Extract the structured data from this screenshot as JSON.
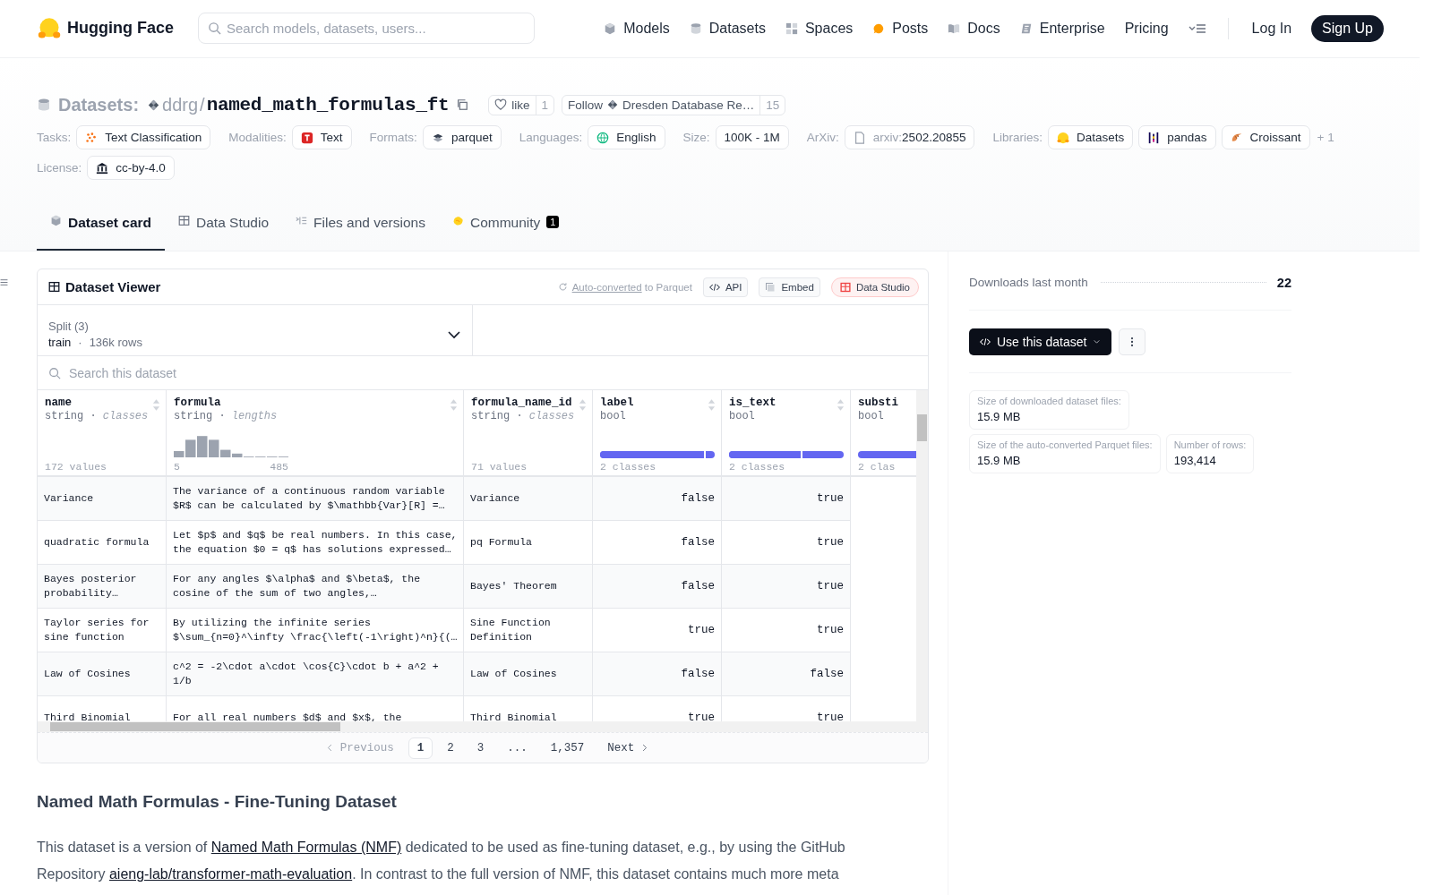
{
  "header": {
    "brand": "Hugging Face",
    "search": {
      "placeholder": "Search models, datasets, users..."
    },
    "nav": [
      "Models",
      "Datasets",
      "Spaces",
      "Posts",
      "Docs",
      "Enterprise",
      "Pricing"
    ],
    "login": "Log In",
    "signup": "Sign Up"
  },
  "repo": {
    "type": "Datasets:",
    "owner": "ddrg",
    "separator": "/",
    "name": "named_math_formulas_ft",
    "like": {
      "label": "like",
      "count": "1"
    },
    "follow": {
      "label": "Follow",
      "org": "Dresden Database Re…",
      "count": "15"
    }
  },
  "tag_rows": [
    [
      {
        "label": "Tasks:",
        "chips": [
          {
            "text": "Text Classification"
          }
        ]
      },
      {
        "label": "Modalities:",
        "chips": [
          {
            "text": "Text"
          }
        ]
      },
      {
        "label": "Formats:",
        "chips": [
          {
            "text": "parquet"
          }
        ]
      },
      {
        "label": "Languages:",
        "chips": [
          {
            "text": "English"
          }
        ]
      },
      {
        "label": "Size:",
        "chips": [
          {
            "text": "100K - 1M"
          }
        ]
      },
      {
        "label": "ArXiv:",
        "chips": [
          {
            "prefix": "arxiv:",
            "text": "2502.20855"
          }
        ]
      },
      {
        "label": "Libraries:",
        "chips": [
          {
            "text": "Datasets"
          },
          {
            "text": "pandas"
          },
          {
            "text": "Croissant"
          }
        ],
        "more": "+ 1"
      }
    ],
    [
      {
        "label": "License:",
        "chips": [
          {
            "text": "cc-by-4.0"
          }
        ]
      }
    ]
  ],
  "tabs": [
    {
      "label": "Dataset card",
      "selected": true
    },
    {
      "label": "Data Studio",
      "selected": false
    },
    {
      "label": "Files and versions",
      "selected": false
    },
    {
      "label": "Community",
      "badge": "1",
      "selected": false
    }
  ],
  "viewer": {
    "title": "Dataset Viewer",
    "converted": {
      "link": "Auto-converted",
      "text": "to Parquet"
    },
    "buttons": [
      "API",
      "Embed",
      "Data Studio"
    ],
    "split": {
      "label": "Split (3)",
      "value": "train",
      "separator": "·",
      "rows": "136k rows"
    },
    "search": {
      "placeholder": "Search this dataset"
    },
    "columns": [
      {
        "name": "name",
        "sortable": true,
        "type": "string",
        "separator": "·",
        "stat": "classes",
        "kind": "classes",
        "footer": "172 values"
      },
      {
        "name": "formula",
        "sortable": true,
        "type": "string",
        "separator": "·",
        "stat": "lengths",
        "kind": "lengths",
        "min": "5",
        "max": "485"
      },
      {
        "name": "formula_name_id",
        "sortable": true,
        "type": "string",
        "separator": "·",
        "stat": "classes",
        "kind": "classes",
        "footer": "71 values"
      },
      {
        "name": "label",
        "sortable": true,
        "type": "bool",
        "kind": "bool",
        "level": 0.92,
        "footer": "2 classes"
      },
      {
        "name": "is_text",
        "sortable": true,
        "type": "bool",
        "kind": "bool",
        "level": 0.64,
        "footer": "2 classes"
      },
      {
        "name": "substi",
        "type": "bool",
        "kind": "bool",
        "level": 1,
        "footer": "2 clas"
      }
    ],
    "rows": [
      [
        "Variance",
        "The variance of a continuous random variable\n$R$ can be calculated by $\\mathbb{Var}[R] =…",
        "Variance",
        "false",
        "true"
      ],
      [
        "quadratic formula",
        "Let $p$ and $q$ be real numbers. In this case,\nthe equation $0 = q$ has solutions expressed…",
        "pq Formula",
        "false",
        "true"
      ],
      [
        "Bayes posterior\nprobability…",
        "For any angles $\\alpha$ and $\\beta$, the\ncosine of the sum of two angles,…",
        "Bayes' Theorem",
        "false",
        "true"
      ],
      [
        "Taylor series for\nsine function",
        "By utilizing the infinite series\n$\\sum_{n=0}^\\infty \\frac{\\left(-1\\right)^n}{(…",
        "Sine Function\nDefinition",
        "true",
        "true"
      ],
      [
        "Law of Cosines",
        "c^2 = -2\\cdot a\\cdot \\cos{C}\\cdot b + a^2 +\n1/b",
        "Law of Cosines",
        "false",
        "false"
      ],
      [
        "Third Binomial",
        "For all real numbers $d$ and $x$, the",
        "Third Binomial",
        "true",
        "true"
      ]
    ],
    "previous": {
      "label": "Previous",
      "disabled": true
    },
    "pages": [
      {
        "label": "1",
        "selected": true
      },
      {
        "label": "2",
        "selected": false
      },
      {
        "label": "3",
        "selected": false
      },
      {
        "label": "...",
        "selected": false
      },
      {
        "label": "1,357",
        "selected": false
      }
    ],
    "next": {
      "label": "Next",
      "disabled": false
    }
  },
  "sidebar": {
    "downloads": {
      "label": "Downloads last month",
      "value": "22"
    },
    "use_button": "Use this dataset",
    "stats": [
      {
        "label": "Size of downloaded dataset files:",
        "value": "15.9 MB"
      },
      {
        "label": "Size of the auto-converted Parquet files:",
        "value": "15.9 MB"
      },
      {
        "label": "Number of rows:",
        "value": "193,414"
      }
    ]
  },
  "card": {
    "heading": "Named Math Formulas - Fine-Tuning Dataset",
    "lines": [
      [
        {
          "kind": "text",
          "text": "This dataset is a version of "
        },
        {
          "kind": "link",
          "text": "Named Math Formulas (NMF)"
        },
        {
          "kind": "text",
          "text": " dedicated to be used as fine-tuning dataset, e.g., by using the GitHub"
        }
      ],
      [
        {
          "kind": "text",
          "text": "Repository "
        },
        {
          "kind": "link",
          "text": "aieng-lab/transformer-math-evaluation"
        },
        {
          "kind": "text",
          "text": ". In contrast to the full version of NMF, this dataset contains much more meta"
        }
      ]
    ]
  }
}
